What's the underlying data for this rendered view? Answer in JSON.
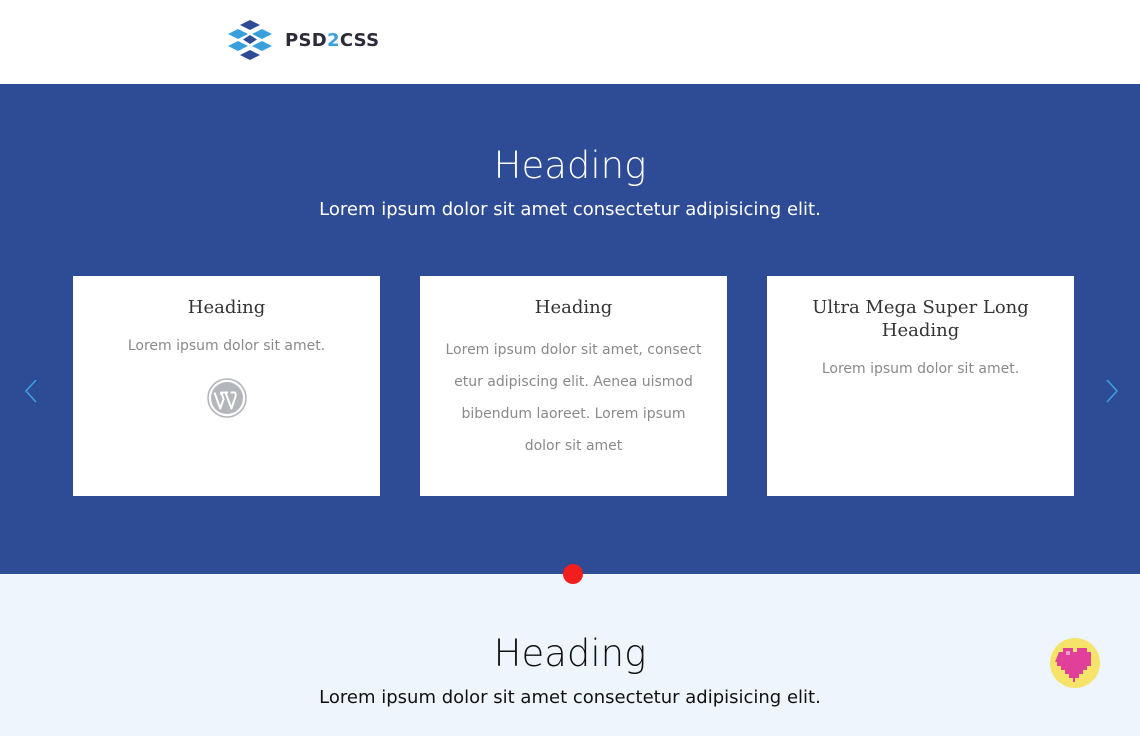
{
  "header": {
    "brand": {
      "part1": "PSD",
      "part2": "2",
      "part3": "CSS",
      "icon": "psd2css-logo-icon"
    }
  },
  "hero": {
    "title": "Heading",
    "subtitle": "Lorem ipsum dolor sit amet consectetur adipisicing elit.",
    "cards": [
      {
        "title": "Heading",
        "text": "Lorem ipsum dolor sit amet.",
        "icon": "wordpress-icon"
      },
      {
        "title": "Heading",
        "text": "Lorem ipsum dolor sit amet, consect etur adipiscing elit. Aenea uismod bibendum laoreet. Lorem ipsum dolor sit amet"
      },
      {
        "title": "Ultra Mega Super Long Heading",
        "text": "Lorem ipsum dolor sit amet."
      }
    ],
    "prev_icon": "chevron-left-icon",
    "next_icon": "chevron-right-icon"
  },
  "section2": {
    "title": "Heading",
    "subtitle": "Lorem ipsum dolor sit amet consectetur adipisicing elit."
  },
  "colors": {
    "hero_bg": "#2e4b95",
    "section2_bg": "#eff5fc",
    "accent": "#3aa0dc",
    "dot": "#f21d1d",
    "heart": "#e0409a",
    "heart_bg": "#f5e36a"
  }
}
